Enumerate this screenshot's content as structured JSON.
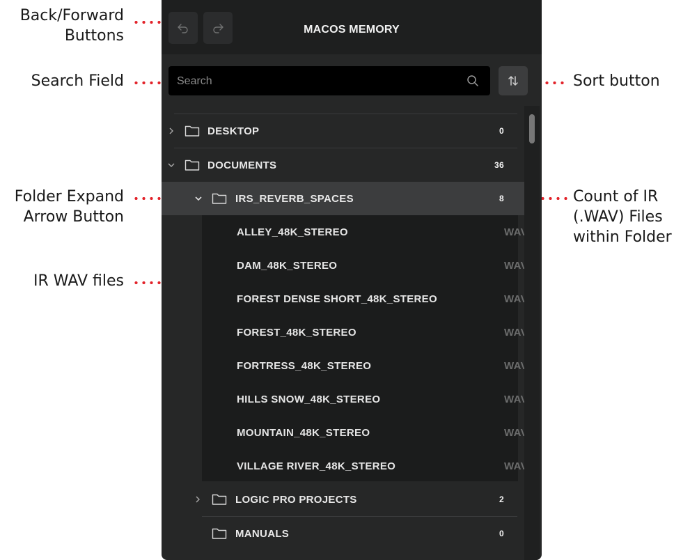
{
  "callouts": {
    "back_forward": [
      "Back/Forward",
      "Buttons"
    ],
    "search_field": "Search Field",
    "sort_button": "Sort button",
    "folder_expand": [
      "Folder Expand",
      "Arrow Button"
    ],
    "ir_count": [
      "Count of IR",
      "(.WAV) Files",
      "within Folder"
    ],
    "ir_wav_files": "IR WAV files"
  },
  "header": {
    "title": "MACOS MEMORY"
  },
  "search": {
    "placeholder": "Search"
  },
  "tree": {
    "desktop": {
      "label": "DESKTOP",
      "count": "0"
    },
    "documents": {
      "label": "DOCUMENTS",
      "count": "36"
    },
    "irs": {
      "label": "IRS_REVERB_SPACES",
      "count": "8"
    },
    "files": [
      {
        "name": "ALLEY_48K_STEREO",
        "ext": "WAV"
      },
      {
        "name": "DAM_48K_STEREO",
        "ext": "WAV"
      },
      {
        "name": "FOREST DENSE SHORT_48K_STEREO",
        "ext": "WAV"
      },
      {
        "name": "FOREST_48K_STEREO",
        "ext": "WAV"
      },
      {
        "name": "FORTRESS_48K_STEREO",
        "ext": "WAV"
      },
      {
        "name": "HILLS SNOW_48K_STEREO",
        "ext": "WAV"
      },
      {
        "name": "MOUNTAIN_48K_STEREO",
        "ext": "WAV"
      },
      {
        "name": "VILLAGE RIVER_48K_STEREO",
        "ext": "WAV"
      }
    ],
    "logic": {
      "label": "LOGIC PRO PROJECTS",
      "count": "2"
    },
    "manuals": {
      "label": "MANUALS",
      "count": "0"
    }
  },
  "colors": {
    "callout_dots": "#e2232a",
    "panel": "#262727",
    "selected_row": "#3c3d3e"
  }
}
